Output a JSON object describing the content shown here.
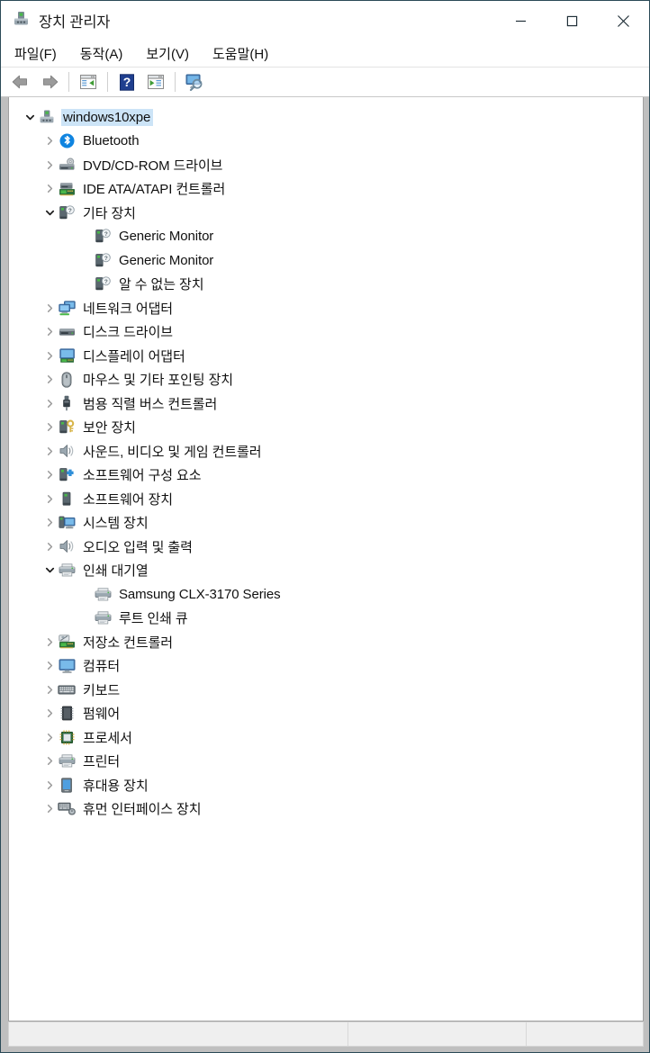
{
  "window": {
    "title": "장치 관리자",
    "app_icon": "device-manager-icon",
    "controls": {
      "minimize_label": "최소화",
      "maximize_label": "최대화",
      "close_label": "닫기"
    }
  },
  "menubar": {
    "items": [
      {
        "label": "파일(F)",
        "name": "menu-file"
      },
      {
        "label": "동작(A)",
        "name": "menu-action"
      },
      {
        "label": "보기(V)",
        "name": "menu-view"
      },
      {
        "label": "도움말(H)",
        "name": "menu-help"
      }
    ]
  },
  "toolbar": {
    "buttons": [
      {
        "icon": "back-arrow-icon",
        "label": "뒤로"
      },
      {
        "icon": "forward-arrow-icon",
        "label": "앞으로"
      },
      {
        "icon": "properties-icon",
        "label": "속성"
      },
      {
        "icon": "help-icon",
        "label": "도움말"
      },
      {
        "icon": "update-driver-icon",
        "label": "드라이버 업데이트"
      },
      {
        "icon": "scan-hardware-icon",
        "label": "하드웨어 변경 사항 검색"
      }
    ]
  },
  "tree": {
    "nodes": [
      {
        "label": "windows10xpe",
        "level": 0,
        "state": "expanded",
        "icon": "computer-root-icon",
        "selected": true
      },
      {
        "label": "Bluetooth",
        "level": 1,
        "state": "collapsed",
        "icon": "bluetooth-icon",
        "selected": false
      },
      {
        "label": "DVD/CD-ROM 드라이브",
        "level": 1,
        "state": "collapsed",
        "icon": "dvd-drive-icon",
        "selected": false
      },
      {
        "label": "IDE ATA/ATAPI 컨트롤러",
        "level": 1,
        "state": "collapsed",
        "icon": "ide-controller-icon",
        "selected": false
      },
      {
        "label": "기타 장치",
        "level": 1,
        "state": "expanded",
        "icon": "unknown-device-icon",
        "selected": false
      },
      {
        "label": "Generic Monitor",
        "level": 2,
        "state": "leaf",
        "icon": "unknown-device-icon",
        "selected": false
      },
      {
        "label": "Generic Monitor",
        "level": 2,
        "state": "leaf",
        "icon": "unknown-device-icon",
        "selected": false
      },
      {
        "label": "알 수 없는 장치",
        "level": 2,
        "state": "leaf",
        "icon": "unknown-device-icon",
        "selected": false
      },
      {
        "label": "네트워크 어댑터",
        "level": 1,
        "state": "collapsed",
        "icon": "network-adapter-icon",
        "selected": false
      },
      {
        "label": "디스크 드라이브",
        "level": 1,
        "state": "collapsed",
        "icon": "disk-drive-icon",
        "selected": false
      },
      {
        "label": "디스플레이 어댑터",
        "level": 1,
        "state": "collapsed",
        "icon": "display-adapter-icon",
        "selected": false
      },
      {
        "label": "마우스 및 기타 포인팅 장치",
        "level": 1,
        "state": "collapsed",
        "icon": "mouse-icon",
        "selected": false
      },
      {
        "label": "범용 직렬 버스 컨트롤러",
        "level": 1,
        "state": "collapsed",
        "icon": "usb-icon",
        "selected": false
      },
      {
        "label": "보안 장치",
        "level": 1,
        "state": "collapsed",
        "icon": "security-device-icon",
        "selected": false
      },
      {
        "label": "사운드, 비디오 및 게임 컨트롤러",
        "level": 1,
        "state": "collapsed",
        "icon": "speaker-icon",
        "selected": false
      },
      {
        "label": "소프트웨어 구성 요소",
        "level": 1,
        "state": "collapsed",
        "icon": "software-component-icon",
        "selected": false
      },
      {
        "label": "소프트웨어 장치",
        "level": 1,
        "state": "collapsed",
        "icon": "software-device-icon",
        "selected": false
      },
      {
        "label": "시스템 장치",
        "level": 1,
        "state": "collapsed",
        "icon": "system-device-icon",
        "selected": false
      },
      {
        "label": "오디오 입력 및 출력",
        "level": 1,
        "state": "collapsed",
        "icon": "speaker-icon",
        "selected": false
      },
      {
        "label": "인쇄 대기열",
        "level": 1,
        "state": "expanded",
        "icon": "printer-icon",
        "selected": false
      },
      {
        "label": "Samsung CLX-3170 Series",
        "level": 2,
        "state": "leaf",
        "icon": "printer-icon",
        "selected": false
      },
      {
        "label": "루트 인쇄 큐",
        "level": 2,
        "state": "leaf",
        "icon": "printer-icon",
        "selected": false
      },
      {
        "label": "저장소 컨트롤러",
        "level": 1,
        "state": "collapsed",
        "icon": "storage-controller-icon",
        "selected": false
      },
      {
        "label": "컴퓨터",
        "level": 1,
        "state": "collapsed",
        "icon": "monitor-icon",
        "selected": false
      },
      {
        "label": "키보드",
        "level": 1,
        "state": "collapsed",
        "icon": "keyboard-icon",
        "selected": false
      },
      {
        "label": "펌웨어",
        "level": 1,
        "state": "collapsed",
        "icon": "firmware-icon",
        "selected": false
      },
      {
        "label": "프로세서",
        "level": 1,
        "state": "collapsed",
        "icon": "processor-icon",
        "selected": false
      },
      {
        "label": "프린터",
        "level": 1,
        "state": "collapsed",
        "icon": "printer-icon",
        "selected": false
      },
      {
        "label": "휴대용 장치",
        "level": 1,
        "state": "collapsed",
        "icon": "portable-device-icon",
        "selected": false
      },
      {
        "label": "휴먼 인터페이스 장치",
        "level": 1,
        "state": "collapsed",
        "icon": "hid-icon",
        "selected": false
      }
    ]
  },
  "statusbar": {
    "cells": [
      "",
      "",
      ""
    ]
  },
  "colors": {
    "selection": "#cce4f7",
    "window_border": "#2b4a57",
    "content_frame": "#bfbfbf",
    "accent_green": "#5fba46",
    "bluetooth_blue": "#0f84e0"
  }
}
